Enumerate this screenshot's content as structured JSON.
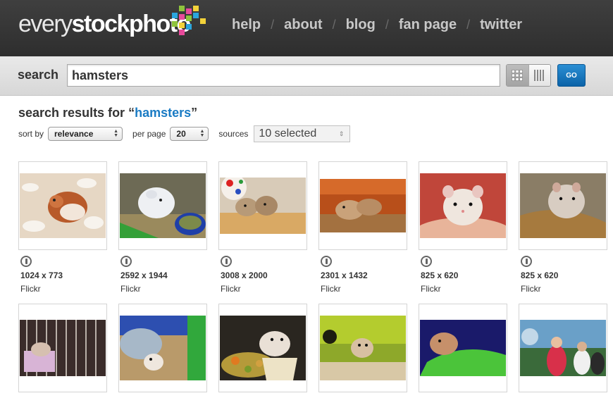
{
  "logo": {
    "part1": "every",
    "part2": "stockphoto"
  },
  "nav": [
    "help",
    "about",
    "blog",
    "fan page",
    "twitter"
  ],
  "search": {
    "label": "search",
    "value": "hamsters",
    "go_label": "GO"
  },
  "results": {
    "prefix": "search results for “",
    "query": "hamsters",
    "suffix": "”"
  },
  "controls": {
    "sort_label": "sort by",
    "sort_value": "relevance",
    "perpage_label": "per page",
    "perpage_value": "20",
    "sources_label": "sources",
    "sources_value": "10 selected"
  },
  "colors": {
    "accent": "#1a7bc4",
    "header": "#333333",
    "go_button": "#0b63a8"
  },
  "images": [
    {
      "dims": "1024 x 773",
      "source": "Flickr"
    },
    {
      "dims": "2592 x 1944",
      "source": "Flickr"
    },
    {
      "dims": "3008 x 2000",
      "source": "Flickr"
    },
    {
      "dims": "2301 x 1432",
      "source": "Flickr"
    },
    {
      "dims": "825 x 620",
      "source": "Flickr"
    },
    {
      "dims": "825 x 620",
      "source": "Flickr"
    },
    {
      "dims": "",
      "source": ""
    },
    {
      "dims": "",
      "source": ""
    },
    {
      "dims": "",
      "source": ""
    },
    {
      "dims": "",
      "source": ""
    },
    {
      "dims": "",
      "source": ""
    },
    {
      "dims": "",
      "source": ""
    }
  ]
}
